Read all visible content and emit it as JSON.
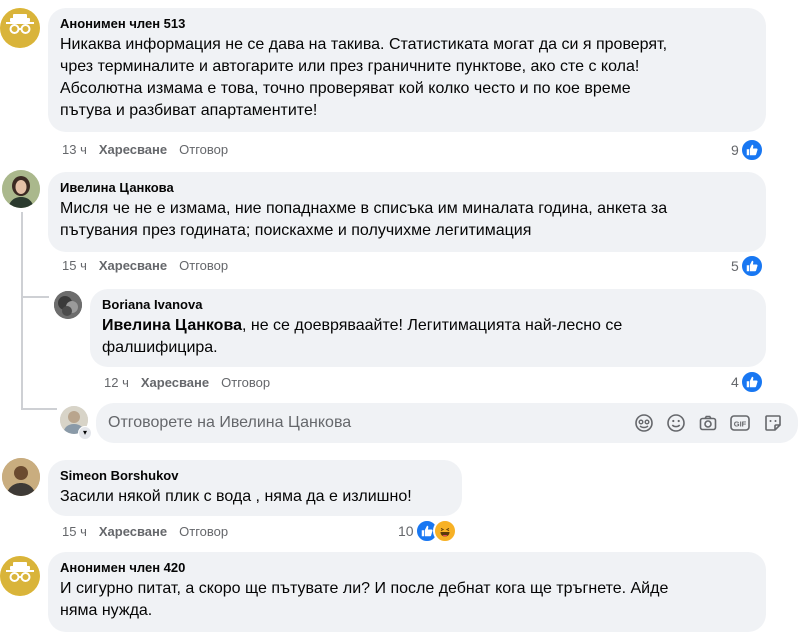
{
  "comments": [
    {
      "author": "Анонимен член 513",
      "text": "Никаква информация не се дава на такива. Статистиката могат да си я проверят,\nчрез терминалите и автогарите или през граничните пунктове, ако сте с кола!\nАбсолютна измама е това, точно проверяват кой колко често и по кое време\nпътува и разбиват апартаментите!",
      "time": "13 ч",
      "like": "Харесване",
      "reply": "Отговор",
      "reactions": "9"
    },
    {
      "author": "Ивелина Цанкова",
      "text": "Мисля че не е измама, ние попаднахме в списъка им миналата година, анкета за\nпътувания през годината; поискахме и получихме легитимация",
      "time": "15 ч",
      "like": "Харесване",
      "reply": "Отговор",
      "reactions": "5"
    },
    {
      "author": "Boriana Ivanova",
      "mention": "Ивелина Цанкова",
      "text": ", не се доевряваайте! Легитимацията най-лесно се\nфалшифицира.",
      "time": "12 ч",
      "like": "Харесване",
      "reply": "Отговор",
      "reactions": "4"
    },
    {
      "author": "Simeon Borshukov",
      "text": "Засили някой плик с вода , няма да е излишно!",
      "time": "15 ч",
      "like": "Харесване",
      "reply": "Отговор",
      "reactions": "10"
    },
    {
      "author": "Анонимен член 420",
      "text": "И сигурно питат, а скоро ще пътувате ли? И после дебнат кога ще тръгнете. Айде\nняма нужда."
    }
  ],
  "reply_box": {
    "placeholder": "Отговорете на Ивелина Цанкова",
    "icons": [
      "avatar-sticker-icon",
      "emoji-icon",
      "camera-icon",
      "gif-icon",
      "sticker-icon"
    ]
  },
  "colors": {
    "like_blue": "#1877f2",
    "bubble_bg": "#f0f2f5",
    "meta_gray": "#65676b"
  }
}
